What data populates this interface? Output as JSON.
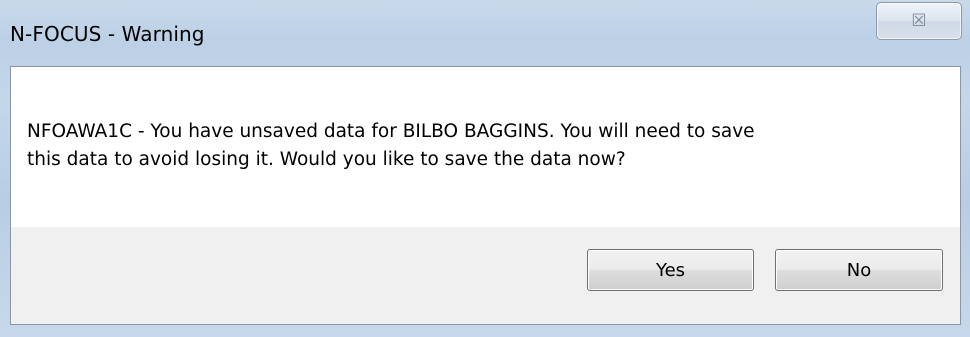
{
  "window": {
    "title": "N-FOCUS - Warning",
    "close_glyph": "☒"
  },
  "message": {
    "lines": [
      "NFOAWA1C - You have unsaved data for BILBO BAGGINS.  You will need to save",
      "this data to avoid losing it.  Would you like to save the data now?"
    ]
  },
  "buttons": {
    "yes_label": "Yes",
    "no_label": "No"
  },
  "icons": {
    "close": "close-icon"
  },
  "colors": {
    "title_bar": "#c4d6ea",
    "content_bg": "#ffffff",
    "footer_bg": "#f0f0f0"
  }
}
